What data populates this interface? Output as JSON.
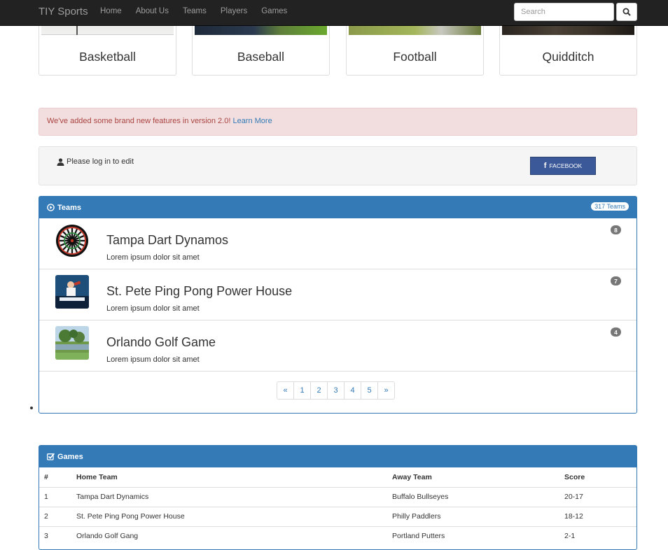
{
  "navbar": {
    "brand": "TIY Sports",
    "links": [
      "Home",
      "About Us",
      "Teams",
      "Players",
      "Games"
    ],
    "search_placeholder": "Search"
  },
  "sports": [
    "Basketball",
    "Baseball",
    "Football",
    "Quidditch"
  ],
  "alert": {
    "text": "We've added some brand new features in version 2.0!",
    "link": "Learn More"
  },
  "login": {
    "text": "Please log in to edit",
    "facebook_label": "FACEBOOK"
  },
  "teams_panel": {
    "title": "Teams",
    "count": "317 Teams",
    "teams": [
      {
        "name": "Tampa Dart Dynamos",
        "description": "Lorem ipsum dolor sit amet",
        "badge": "8"
      },
      {
        "name": "St. Pete Ping Pong Power House",
        "description": "Lorem ipsum dolor sit amet",
        "badge": "7"
      },
      {
        "name": "Orlando Golf Game",
        "description": "Lorem ipsum dolor sit amet",
        "badge": "4"
      }
    ],
    "pagination": [
      "«",
      "1",
      "2",
      "3",
      "4",
      "5",
      "»"
    ]
  },
  "games_panel": {
    "title": "Games",
    "columns": [
      "#",
      "Home Team",
      "Away Team",
      "Score"
    ],
    "rows": [
      [
        "1",
        "Tampa Dart Dynamics",
        "Buffalo Bullseyes",
        "20-17"
      ],
      [
        "2",
        "St. Pete Ping Pong Power House",
        "Philly Paddlers",
        "18-12"
      ],
      [
        "3",
        "Orlando Golf Gang",
        "Portland Putters",
        "2-1"
      ]
    ]
  },
  "colors": {
    "navbar": "#222222",
    "primary": "#337ab7",
    "alert_bg": "#f2dede",
    "facebook": "#3b5998"
  }
}
